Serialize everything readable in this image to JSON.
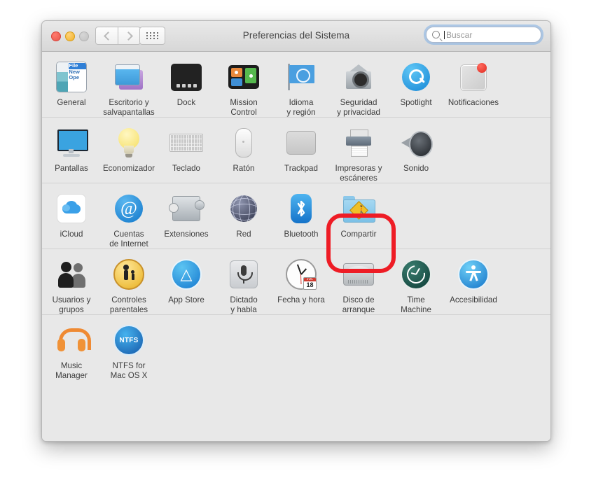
{
  "window": {
    "title": "Preferencias del Sistema",
    "traffic_lights": [
      "close",
      "minimize",
      "zoom"
    ],
    "nav": {
      "back_label": "‹",
      "forward_label": "›",
      "grid_label": "grid"
    },
    "search": {
      "placeholder": "Buscar",
      "value": ""
    }
  },
  "rows": [
    {
      "id": "personal",
      "panes": [
        {
          "id": "general",
          "label": "General",
          "icon": "general-icon"
        },
        {
          "id": "desktop",
          "label": "Escritorio y\nsalvapantallas",
          "icon": "desktop-screensaver-icon"
        },
        {
          "id": "dock",
          "label": "Dock",
          "icon": "dock-icon"
        },
        {
          "id": "mission-control",
          "label": "Mission\nControl",
          "icon": "mission-control-icon"
        },
        {
          "id": "language",
          "label": "Idioma\ny región",
          "icon": "language-region-icon"
        },
        {
          "id": "security",
          "label": "Seguridad\ny privacidad",
          "icon": "security-privacy-icon"
        },
        {
          "id": "spotlight",
          "label": "Spotlight",
          "icon": "spotlight-icon"
        },
        {
          "id": "notifications",
          "label": "Notificaciones",
          "icon": "notifications-icon"
        }
      ]
    },
    {
      "id": "hardware",
      "panes": [
        {
          "id": "displays",
          "label": "Pantallas",
          "icon": "displays-icon"
        },
        {
          "id": "energy",
          "label": "Economizador",
          "icon": "energy-saver-icon"
        },
        {
          "id": "keyboard",
          "label": "Teclado",
          "icon": "keyboard-icon"
        },
        {
          "id": "mouse",
          "label": "Ratón",
          "icon": "mouse-icon"
        },
        {
          "id": "trackpad",
          "label": "Trackpad",
          "icon": "trackpad-icon"
        },
        {
          "id": "printers",
          "label": "Impresoras y\nescáneres",
          "icon": "printers-scanners-icon"
        },
        {
          "id": "sound",
          "label": "Sonido",
          "icon": "sound-icon"
        }
      ]
    },
    {
      "id": "internet",
      "panes": [
        {
          "id": "icloud",
          "label": "iCloud",
          "icon": "icloud-icon"
        },
        {
          "id": "internet-accounts",
          "label": "Cuentas\nde Internet",
          "icon": "internet-accounts-icon"
        },
        {
          "id": "extensions",
          "label": "Extensiones",
          "icon": "extensions-icon"
        },
        {
          "id": "network",
          "label": "Red",
          "icon": "network-icon"
        },
        {
          "id": "bluetooth",
          "label": "Bluetooth",
          "icon": "bluetooth-icon"
        },
        {
          "id": "sharing",
          "label": "Compartir",
          "icon": "sharing-icon",
          "highlighted": true
        }
      ]
    },
    {
      "id": "system",
      "panes": [
        {
          "id": "users",
          "label": "Usuarios y\ngrupos",
          "icon": "users-groups-icon"
        },
        {
          "id": "parental",
          "label": "Controles\nparentales",
          "icon": "parental-controls-icon"
        },
        {
          "id": "app-store",
          "label": "App Store",
          "icon": "app-store-icon"
        },
        {
          "id": "dictation",
          "label": "Dictado\ny habla",
          "icon": "dictation-speech-icon"
        },
        {
          "id": "datetime",
          "label": "Fecha y hora",
          "icon": "date-time-icon"
        },
        {
          "id": "startup-disk",
          "label": "Disco de\narranque",
          "icon": "startup-disk-icon"
        },
        {
          "id": "time-machine",
          "label": "Time\nMachine",
          "icon": "time-machine-icon"
        },
        {
          "id": "accessibility",
          "label": "Accesibilidad",
          "icon": "accessibility-icon"
        }
      ]
    },
    {
      "id": "other",
      "panes": [
        {
          "id": "music-manager",
          "label": "Music\nManager",
          "icon": "music-manager-icon"
        },
        {
          "id": "ntfs",
          "label": "NTFS for\nMac OS X",
          "icon": "ntfs-icon"
        }
      ]
    }
  ],
  "icon_details": {
    "date_time_month": "JUL",
    "date_time_day": "18",
    "ntfs_text": "NTFS",
    "general_text_top": "File",
    "general_text_mid": "New",
    "general_text_bot": "Ope"
  },
  "annotation": {
    "type": "rounded-rect-highlight",
    "target": "Compartir",
    "color": "#ee1c25"
  }
}
